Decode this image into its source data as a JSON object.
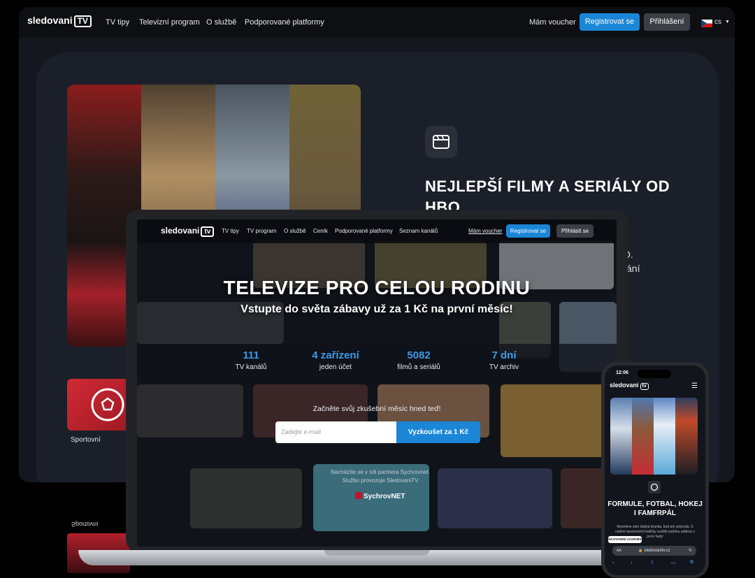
{
  "colors": {
    "accent": "#1b86d6",
    "stat_blue": "#3a9be8",
    "sport_red": "#d02a35"
  },
  "desktop": {
    "logo_text": "sledovani",
    "logo_box": "TV",
    "nav": [
      "TV tipy",
      "Televizní program",
      "O službě",
      "Podporované platformy"
    ],
    "voucher": "Mám voucher",
    "register": "Registrovat se",
    "login": "Přihlášení",
    "lang": "cs",
    "feature_heading": "NEJLEPŠÍ FILMY A SERIÁLY OD HBO",
    "feature_text_partial": [
      "O.",
      "vání"
    ],
    "sport_label": "Sportovní",
    "reflect_label": "Sportovní",
    "feature_icon": "clapperboard-icon",
    "sport_icon": "football-icon"
  },
  "laptop": {
    "logo_text": "sledovani",
    "logo_box": "tv",
    "nav": [
      "TV tipy",
      "TV program",
      "O službě",
      "Ceník",
      "Podporované platformy",
      "Seznam kanálů"
    ],
    "voucher": "Mám voucher",
    "register": "Registrovat se",
    "login": "Přihlásit se",
    "hero_title": "TELEVIZE PRO CELOU RODINU",
    "hero_subtitle": "Vstupte do světa zábavy už za 1 Kč na první měsíc!",
    "stats": [
      {
        "value": "111",
        "label": "TV kanálů"
      },
      {
        "value": "4 zařízení",
        "label": "jeden účet"
      },
      {
        "value": "5082",
        "label": "filmů a seriálů"
      },
      {
        "value": "7 dní",
        "label": "TV archiv"
      }
    ],
    "cta_text": "Začněte svůj zkušební měsíc hned teď!",
    "email_placeholder": "Zadejte e-mail",
    "try_button": "Vyzkoušet za 1 Kč",
    "partner_line1": "Nacházíte se v síti partnera Sychrovnet.",
    "partner_line2": "Službu provozuje SledovaniTV",
    "partner_logo": "SychrovNET"
  },
  "phone": {
    "time": "12:06",
    "logo_text": "sledovani",
    "logo_box": "tv",
    "heading": "FORMULE, FOTBAL, HOKEJ I FAMFRPÁL",
    "text": "Neunikne vám žádná branka, bod ani sekunda. S našimi sportovními balíčky uvidíte každou událost z první řady!",
    "cookie_button": "NASTAVENÍ COOKIES",
    "url_aa": "AA",
    "url": "sledovanitv.cz"
  }
}
